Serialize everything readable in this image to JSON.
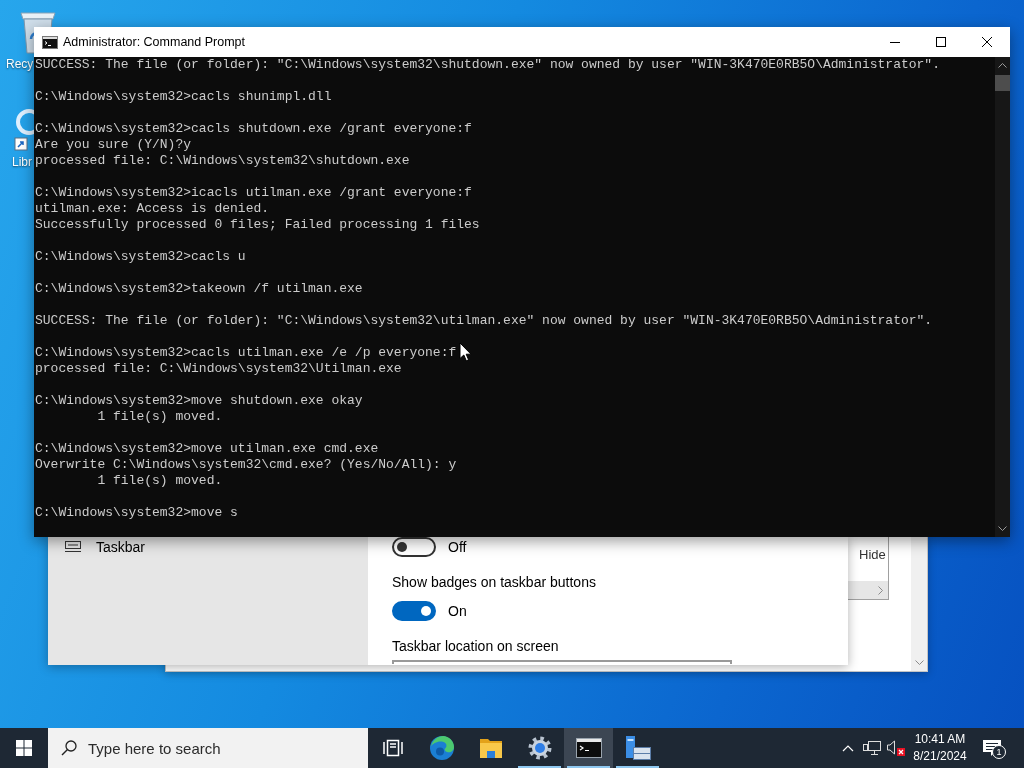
{
  "desktop": {
    "icons": [
      {
        "kind": "recycle-bin",
        "label": "Recy"
      },
      {
        "kind": "shortcut",
        "label": "Libr"
      }
    ]
  },
  "background_window": {
    "panel_label": "Hide"
  },
  "settings_window": {
    "nav_items": [
      {
        "label": "Taskbar"
      }
    ],
    "items": [
      {
        "kind": "toggle",
        "on": false,
        "state_label": "Off"
      },
      {
        "kind": "heading",
        "text": "Show badges on taskbar buttons"
      },
      {
        "kind": "toggle",
        "on": true,
        "state_label": "On"
      },
      {
        "kind": "heading",
        "text": "Taskbar location on screen"
      },
      {
        "kind": "dropdown"
      }
    ]
  },
  "console_window": {
    "title": "Administrator: Command Prompt",
    "blocks": [
      [
        "SUCCESS: The file (or folder): \"C:\\Windows\\system32\\shutdown.exe\" now owned by user \"WIN-3K470E0RB5O\\Administrator\"."
      ],
      [
        "C:\\Windows\\system32>cacls shunimpl.dll"
      ],
      [
        "C:\\Windows\\system32>cacls shutdown.exe /grant everyone:f",
        "Are you sure (Y/N)?y",
        "processed file: C:\\Windows\\system32\\shutdown.exe"
      ],
      [
        "C:\\Windows\\system32>icacls utilman.exe /grant everyone:f",
        "utilman.exe: Access is denied.",
        "Successfully processed 0 files; Failed processing 1 files"
      ],
      [
        "C:\\Windows\\system32>cacls u"
      ],
      [
        "C:\\Windows\\system32>takeown /f utilman.exe"
      ],
      [
        "SUCCESS: The file (or folder): \"C:\\Windows\\system32\\utilman.exe\" now owned by user \"WIN-3K470E0RB5O\\Administrator\"."
      ],
      [
        "C:\\Windows\\system32>cacls utilman.exe /e /p everyone:f",
        "processed file: C:\\Windows\\system32\\Utilman.exe"
      ],
      [
        "C:\\Windows\\system32>move shutdown.exe okay",
        "        1 file(s) moved."
      ],
      [
        "C:\\Windows\\system32>move utilman.exe cmd.exe",
        "Overwrite C:\\Windows\\system32\\cmd.exe? (Yes/No/All): y",
        "        1 file(s) moved."
      ],
      [
        "C:\\Windows\\system32>move s"
      ]
    ]
  },
  "taskbar": {
    "search": {
      "placeholder": "Type here to search"
    },
    "apps": [
      {
        "kind": "task-view",
        "running": false,
        "selected": false
      },
      {
        "kind": "edge",
        "running": false,
        "selected": false
      },
      {
        "kind": "file-explorer",
        "running": false,
        "selected": false
      },
      {
        "kind": "settings",
        "running": true,
        "selected": false
      },
      {
        "kind": "command-prompt",
        "running": true,
        "selected": true
      },
      {
        "kind": "server-manager",
        "running": true,
        "selected": false
      }
    ],
    "tray": {
      "volume_muted": true,
      "time": "10:41 AM",
      "date": "8/21/2024",
      "notification_count": "1"
    }
  }
}
